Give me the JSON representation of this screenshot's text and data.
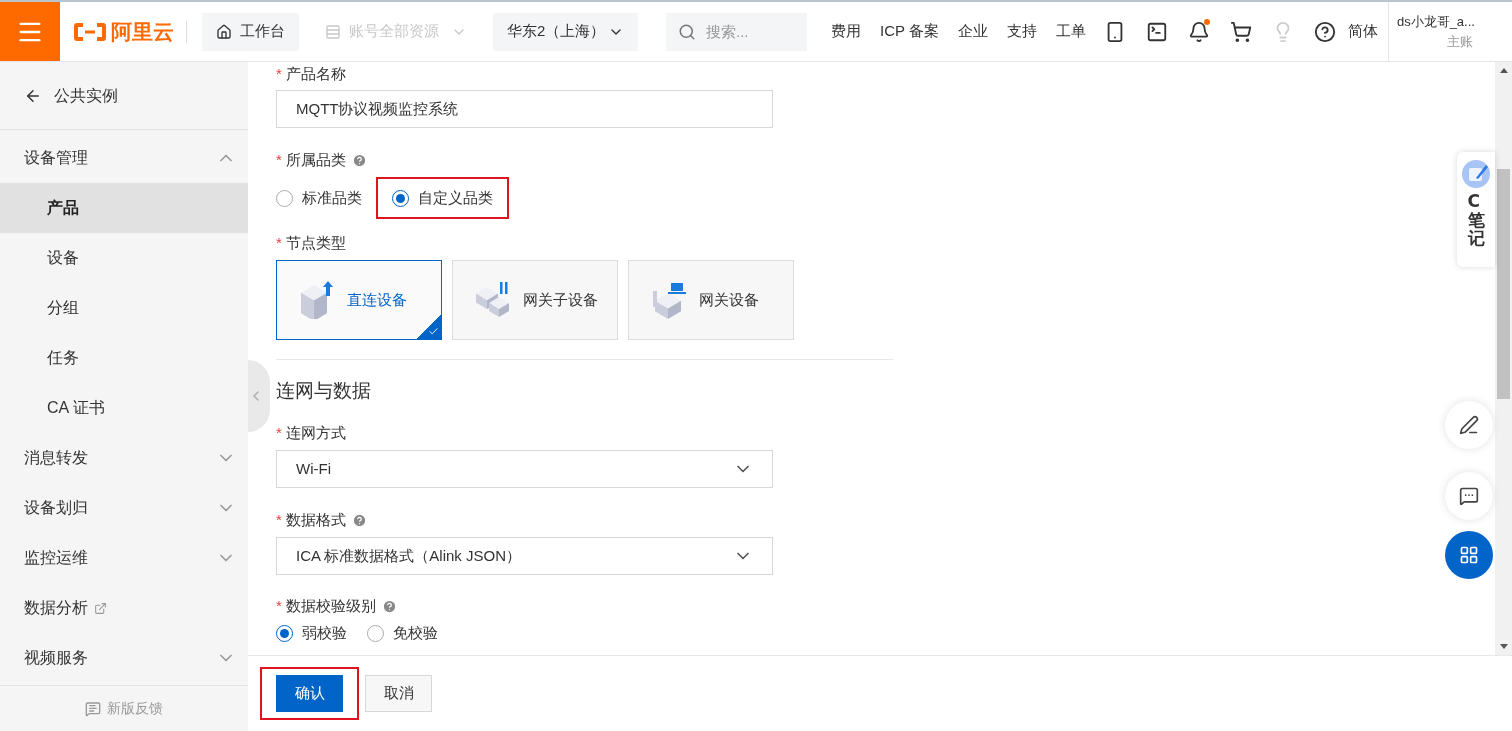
{
  "header": {
    "logo": "阿里云",
    "workbench": "工作台",
    "account_resources": {
      "label": "账号全部资源",
      "disabled": true
    },
    "region": "华东2（上海）",
    "search": {
      "placeholder": "搜索..."
    },
    "nav_links": [
      "费用",
      "ICP 备案",
      "企业",
      "支持",
      "工单"
    ],
    "tools": [
      {
        "kind": "app"
      },
      {
        "kind": "terminal"
      },
      {
        "kind": "bell",
        "has_notification": true
      },
      {
        "kind": "cart"
      },
      {
        "kind": "bulb"
      },
      {
        "kind": "help"
      }
    ],
    "language": "简体",
    "user": {
      "name": "ds小龙哥_a...",
      "role": "主账"
    }
  },
  "sidebar": {
    "back": "公共实例",
    "items": [
      {
        "kind": "group",
        "label": "设备管理",
        "expanded": true,
        "children": [
          {
            "label": "产品",
            "selected": true
          },
          {
            "label": "设备",
            "selected": false
          },
          {
            "label": "分组",
            "selected": false
          },
          {
            "label": "任务",
            "selected": false
          },
          {
            "label": "CA 证书",
            "selected": false
          }
        ]
      },
      {
        "kind": "group",
        "label": "消息转发",
        "expanded": false
      },
      {
        "kind": "group",
        "label": "设备划归",
        "expanded": false
      },
      {
        "kind": "group",
        "label": "监控运维",
        "expanded": false
      },
      {
        "kind": "link",
        "label": "数据分析"
      },
      {
        "kind": "group",
        "label": "视频服务",
        "expanded": false
      }
    ],
    "feedback": "新版反馈"
  },
  "form": {
    "product_name": {
      "marker": "*",
      "label": "产品名称",
      "value": "MQTT协议视频监控系统"
    },
    "category": {
      "marker": "*",
      "label": "所属品类",
      "help": true,
      "options": [
        {
          "label": "标准品类",
          "selected": false,
          "highlighted": false
        },
        {
          "label": "自定义品类",
          "selected": true,
          "highlighted": true
        }
      ]
    },
    "node_type": {
      "marker": "*",
      "label": "节点类型",
      "options": [
        {
          "label": "直连设备",
          "selected": true
        },
        {
          "label": "网关子设备",
          "selected": false
        },
        {
          "label": "网关设备",
          "selected": false
        }
      ]
    },
    "section_title": "连网与数据",
    "network": {
      "marker": "*",
      "label": "连网方式",
      "value": "Wi-Fi"
    },
    "data_format": {
      "marker": "*",
      "label": "数据格式",
      "help": true,
      "value": "ICA 标准数据格式（Alink JSON）"
    },
    "validation": {
      "marker": "*",
      "label": "数据校验级别",
      "help": true,
      "options": [
        {
          "label": "弱校验",
          "selected": true
        },
        {
          "label": "免校验",
          "selected": false
        }
      ]
    }
  },
  "footer": {
    "buttons": [
      {
        "label": "确认",
        "kind": "primary",
        "highlighted": true
      },
      {
        "label": "取消",
        "kind": "default",
        "highlighted": false
      }
    ]
  },
  "note_widget": {
    "label": "C笔记"
  }
}
